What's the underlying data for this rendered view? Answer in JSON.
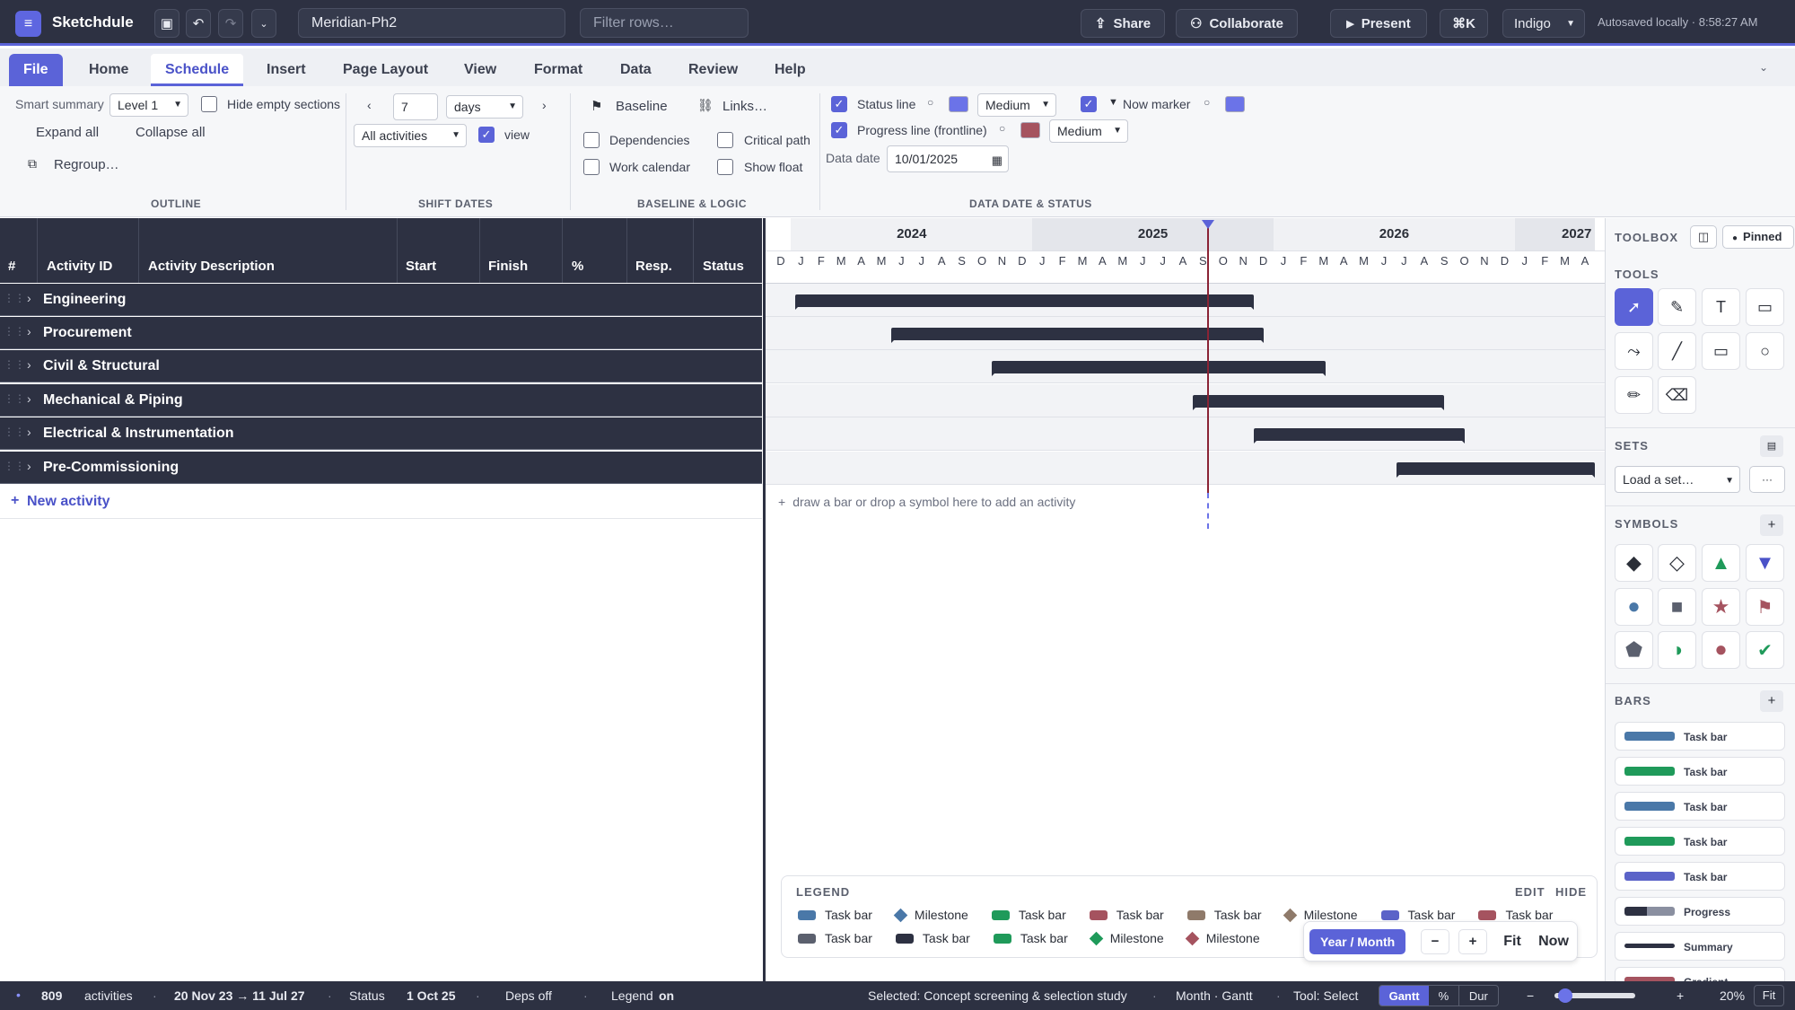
{
  "app": {
    "name": "Sketchdule",
    "doc": "Meridian-Ph2",
    "filter_placeholder": "Filter rows…",
    "share": "Share",
    "collaborate": "Collaborate",
    "present": "Present",
    "cmdk": "⌘K",
    "theme": "Indigo",
    "autosave": "Autosaved locally · 8:58:27 AM"
  },
  "tabs": [
    "File",
    "Home",
    "Schedule",
    "Insert",
    "Page Layout",
    "View",
    "Format",
    "Data",
    "Review",
    "Help"
  ],
  "ribbon": {
    "outline": {
      "title": "OUTLINE",
      "smart_summary": "Smart summary",
      "level": "Level 1",
      "hide_empty": "Hide empty sections",
      "expand": "Expand all",
      "collapse": "Collapse all",
      "regroup": "Regroup…"
    },
    "shift": {
      "title": "SHIFT DATES",
      "amount": "7",
      "unit": "days",
      "scope": "All activities",
      "view": "view"
    },
    "baseline": {
      "title": "BASELINE & LOGIC",
      "baseline": "Baseline",
      "links": "Links…",
      "dependencies": "Dependencies",
      "critical": "Critical path",
      "work_calendar": "Work calendar",
      "show_float": "Show float"
    },
    "status": {
      "title": "DATA DATE & STATUS",
      "status_line": "Status line",
      "weight1": "Medium",
      "now_marker": "Now marker",
      "progress_line": "Progress line (frontline)",
      "weight2": "Medium",
      "data_date_label": "Data date",
      "data_date": "10/01/2025",
      "color_status": "#6b73e8",
      "color_now": "#6b73e8",
      "color_progress": "#a5535f"
    }
  },
  "grid": {
    "headers": [
      "#",
      "Activity ID",
      "Activity Description",
      "Start",
      "Finish",
      "%",
      "Resp.",
      "Status"
    ],
    "rows": [
      "Engineering",
      "Procurement",
      "Civil & Structural",
      "Mechanical & Piping",
      "Electrical & Instrumentation",
      "Pre-Commissioning"
    ],
    "new_activity": "New activity"
  },
  "gantt": {
    "years": [
      "2024",
      "2025",
      "2026",
      "2027"
    ],
    "months": [
      "D",
      "J",
      "F",
      "M",
      "A",
      "M",
      "J",
      "J",
      "A",
      "S",
      "O",
      "N",
      "D",
      "J",
      "F",
      "M",
      "A",
      "M",
      "J",
      "J",
      "A",
      "S",
      "O",
      "N",
      "D",
      "J",
      "F",
      "M",
      "A",
      "M",
      "J",
      "J",
      "A",
      "S",
      "O",
      "N",
      "D",
      "J",
      "F",
      "M",
      "A"
    ],
    "bars": [
      {
        "start": 1.2,
        "end": 24.0
      },
      {
        "start": 6.0,
        "end": 24.5
      },
      {
        "start": 11.0,
        "end": 27.6
      },
      {
        "start": 21.0,
        "end": 33.5
      },
      {
        "start": 24.0,
        "end": 34.5
      },
      {
        "start": 31.1,
        "end": 41.0
      }
    ],
    "now_month": 21.7,
    "hint": "draw a bar or drop a symbol here to add an activity"
  },
  "legend": {
    "title": "LEGEND",
    "edit": "EDIT",
    "hide": "HIDE",
    "row1": [
      {
        "label": "Task bar",
        "color": "#4a78a8",
        "shape": "bar"
      },
      {
        "label": "Milestone",
        "color": "#4a78a8",
        "shape": "diamond"
      },
      {
        "label": "Task bar",
        "color": "#1f9a5a",
        "shape": "bar"
      },
      {
        "label": "Task bar",
        "color": "#a5535f",
        "shape": "bar"
      },
      {
        "label": "Task bar",
        "color": "#8f7a6a",
        "shape": "bar"
      },
      {
        "label": "Milestone",
        "color": "#8f7a6a",
        "shape": "diamond"
      },
      {
        "label": "Task bar",
        "color": "#5b63c8",
        "shape": "bar"
      },
      {
        "label": "Task bar",
        "color": "#a5535f",
        "shape": "bar"
      }
    ],
    "row2": [
      {
        "label": "Task bar",
        "color": "#5b606e",
        "shape": "bar"
      },
      {
        "label": "Task bar",
        "color": "#2d3142",
        "shape": "bar"
      },
      {
        "label": "Task bar",
        "color": "#1f9a5a",
        "shape": "bar"
      },
      {
        "label": "Milestone",
        "color": "#1f9a5a",
        "shape": "diamond"
      },
      {
        "label": "Milestone",
        "color": "#a5535f",
        "shape": "diamond"
      }
    ]
  },
  "zoombar": {
    "mode": "Year / Month",
    "minus": "−",
    "plus": "+",
    "fit": "Fit",
    "now": "Now"
  },
  "toolbox": {
    "title": "TOOLBOX",
    "pinned": "Pinned",
    "tools": "TOOLS",
    "sets": "SETS",
    "load_set": "Load a set…",
    "more": "···",
    "symbols": "SYMBOLS",
    "bars": "BARS",
    "bar_items": [
      "Task bar",
      "Task bar",
      "Task bar",
      "Task bar",
      "Task bar",
      "Progress",
      "Summary",
      "Gradient"
    ]
  },
  "status": {
    "count": "809",
    "activities": "activities",
    "range": "20 Nov 23 → 11 Jul 27",
    "status_label": "Status",
    "status_date": "1 Oct 25",
    "deps": "Deps off",
    "legend_label": "Legend",
    "legend_state": "on",
    "selected": "Selected: Concept screening & selection study",
    "view": "Month · Gantt",
    "tool": "Tool: Select",
    "seg": [
      "Gantt",
      "%",
      "Dur"
    ],
    "zoom_minus": "−",
    "zoom_plus": "+",
    "zoom": "20%",
    "fit": "Fit",
    "zoom_level": 0.07
  }
}
